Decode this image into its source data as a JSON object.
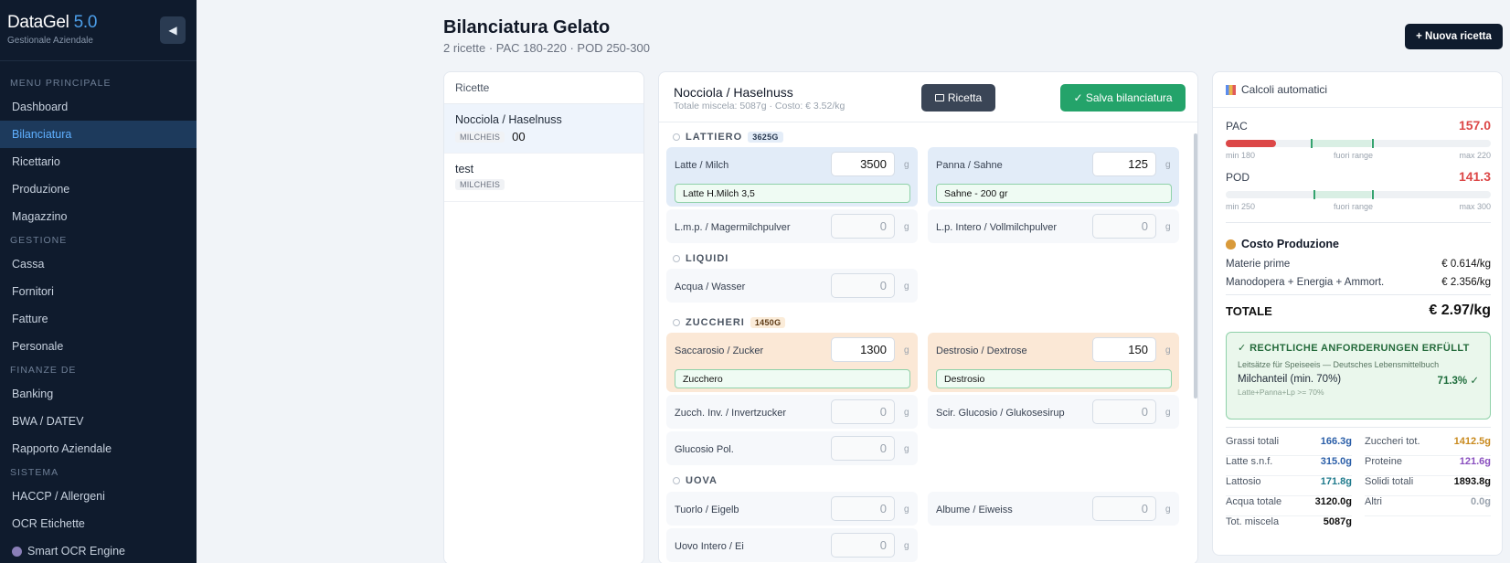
{
  "sidebar": {
    "brand": "DataGel",
    "version": "5.0",
    "subtitle": "Gestionale Aziendale",
    "collapse_icon": "◀",
    "sections": [
      {
        "title": "MENU PRINCIPALE",
        "items": [
          "Dashboard",
          "Bilanciatura",
          "Ricettario",
          "Produzione",
          "Magazzino"
        ]
      },
      {
        "title": "GESTIONE",
        "items": [
          "Cassa",
          "Fornitori",
          "Fatture",
          "Personale"
        ]
      },
      {
        "title": "FINANZE DE",
        "items": [
          "Banking",
          "BWA / DATEV",
          "Rapporto Aziendale"
        ]
      },
      {
        "title": "SISTEMA",
        "items": [
          "HACCP / Allergeni",
          "OCR Etichette",
          "Smart OCR Engine"
        ]
      }
    ],
    "active_item": "Bilanciatura"
  },
  "header": {
    "title": "Bilanciatura Gelato",
    "subtitle": "2 ricette · PAC 180-220 · POD 250-300",
    "new_button": "+ Nuova ricetta"
  },
  "recipes": {
    "header": "Ricette",
    "items": [
      {
        "name": "Nocciola / Haselnuss",
        "tag": "MILCHEIS",
        "qty": "00"
      },
      {
        "name": "test",
        "tag": "MILCHEIS",
        "qty": ""
      }
    ]
  },
  "editor": {
    "title": "Nocciola / Haselnuss",
    "subtitle": "Totale miscela: 5087g · Costo: € 3.52/kg",
    "ricetta_button": "Ricetta",
    "save_button": "✓ Salva bilanciatura",
    "unit": "g",
    "groups": [
      {
        "name": "LATTIERO",
        "badge": "3625G"
      },
      {
        "name": "LIQUIDI",
        "badge": ""
      },
      {
        "name": "ZUCCHERI",
        "badge": "1450G"
      },
      {
        "name": "UOVA",
        "badge": ""
      }
    ],
    "ingredients": {
      "latte": {
        "label": "Latte / Milch",
        "value": "3500",
        "product": "Latte H.Milch 3,5"
      },
      "panna": {
        "label": "Panna / Sahne",
        "value": "125",
        "product": "Sahne - 200 gr"
      },
      "lmp": {
        "label": "L.m.p. / Magermilchpulver",
        "value": "0"
      },
      "lpi": {
        "label": "L.p. Intero / Vollmilchpulver",
        "value": "0"
      },
      "acqua": {
        "label": "Acqua / Wasser",
        "value": "0"
      },
      "saccarosio": {
        "label": "Saccarosio / Zucker",
        "value": "1300",
        "product": "Zucchero"
      },
      "destrosio": {
        "label": "Destrosio / Dextrose",
        "value": "150",
        "product": "Destrosio"
      },
      "invert": {
        "label": "Zucch. Inv. / Invertzucker",
        "value": "0"
      },
      "glucosio": {
        "label": "Scir. Glucosio / Glukosesirup",
        "value": "0"
      },
      "glucpol": {
        "label": "Glucosio Pol.",
        "value": "0"
      },
      "tuorlo": {
        "label": "Tuorlo / Eigelb",
        "value": "0"
      },
      "albume": {
        "label": "Albume / Eiweiss",
        "value": "0"
      },
      "uovo": {
        "label": "Uovo Intero / Ei",
        "value": "0"
      }
    }
  },
  "calc": {
    "header": "Calcoli automatici",
    "pac": {
      "label": "PAC",
      "value": "157.0",
      "min": "min 180",
      "mid": "fuori range",
      "max": "max 220",
      "fill_fraction": 0.19,
      "range_start": 0.32,
      "range_end": 0.55
    },
    "pod": {
      "label": "POD",
      "value": "141.3",
      "min": "min 250",
      "mid": "fuori range",
      "max": "max 300",
      "fill_fraction": 0.0,
      "range_start": 0.33,
      "range_end": 0.55
    },
    "cost_title": "Costo Produzione",
    "materie_label": "Materie prime",
    "materie_value": "€ 0.614/kg",
    "mano_label": "Manodopera + Energia + Ammort.",
    "mano_value": "€ 2.356/kg",
    "totale_label": "TOTALE",
    "totale_value": "€ 2.97/kg",
    "legal": {
      "title": "✓ RECHTLICHE ANFORDERUNGEN ERFÜLLT",
      "subtitle": "Leitsätze für Speiseeis — Deutsches Lebensmittelbuch",
      "row_label": "Milchanteil (min. 70%)",
      "row_value": "71.3% ✓",
      "note": "Latte+Panna+Lp >= 70%"
    },
    "stats": {
      "grassi": {
        "label": "Grassi totali",
        "value": "166.3g"
      },
      "zuccheri": {
        "label": "Zuccheri tot.",
        "value": "1412.5g"
      },
      "latte": {
        "label": "Latte s.n.f.",
        "value": "315.0g"
      },
      "proteine": {
        "label": "Proteine",
        "value": "121.6g"
      },
      "lattosio": {
        "label": "Lattosio",
        "value": "171.8g"
      },
      "solidi": {
        "label": "Solidi totali",
        "value": "1893.8g"
      },
      "acqua": {
        "label": "Acqua totale",
        "value": "3120.0g"
      },
      "altri": {
        "label": "Altri",
        "value": "0.0g"
      },
      "miscela": {
        "label": "Tot. miscela",
        "value": "5087g"
      }
    },
    "colors": {
      "danger": "#dc4747",
      "ok": "#34a36e",
      "blue": "#2a5ea8",
      "orange": "#c98a1e",
      "purple": "#8a4fbf",
      "teal": "#1f7a8c"
    }
  }
}
